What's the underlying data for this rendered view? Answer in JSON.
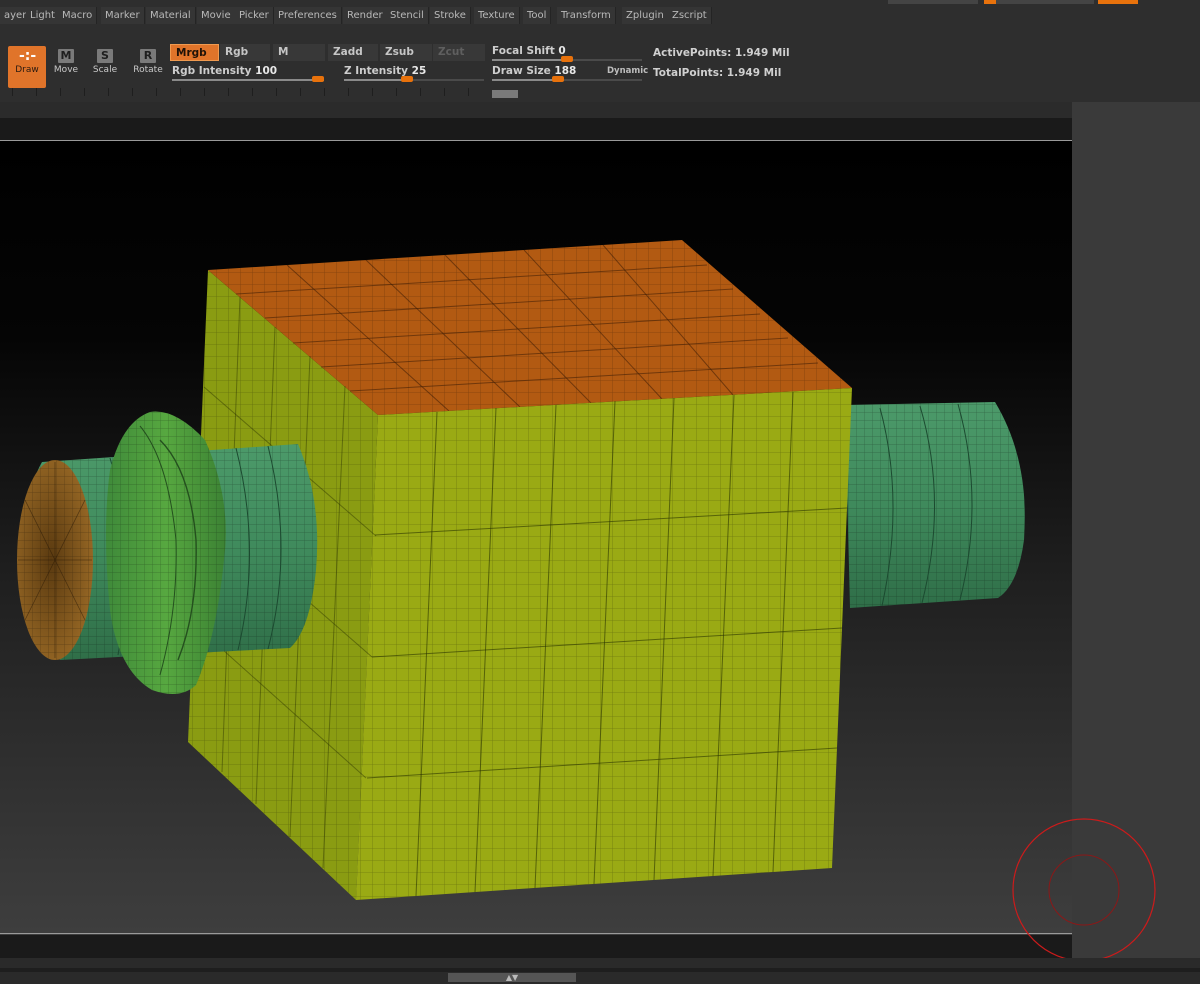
{
  "menu": [
    "ayer",
    "Light",
    "Macro",
    "Marker",
    "Material",
    "Movie",
    "Picker",
    "Preferences",
    "Render",
    "Stencil",
    "Stroke",
    "Texture",
    "Tool",
    "Transform",
    "Zplugin",
    "Zscript"
  ],
  "tools": {
    "draw": {
      "label": "Draw",
      "icon": "draw-crosshair-icon",
      "glyph": "-:-"
    },
    "move": {
      "label": "Move",
      "icon": "move-icon",
      "glyph": "M"
    },
    "scale": {
      "label": "Scale",
      "icon": "scale-icon",
      "glyph": "S"
    },
    "rotate": {
      "label": "Rotate",
      "icon": "rotate-icon",
      "glyph": "R"
    }
  },
  "modes": {
    "mrgb": "Mrgb",
    "rgb": "Rgb",
    "m": "M",
    "zadd": "Zadd",
    "zsub": "Zsub",
    "zcut": "Zcut"
  },
  "sliders": {
    "rgb_intensity": {
      "label": "Rgb Intensity",
      "value": "100"
    },
    "z_intensity": {
      "label": "Z Intensity",
      "value": "25"
    },
    "focal_shift": {
      "label": "Focal Shift",
      "value": "0"
    },
    "draw_size": {
      "label": "Draw Size",
      "value": "188"
    },
    "dynamic_label": "Dynamic"
  },
  "stats": {
    "active_points": "ActivePoints: 1.949 Mil",
    "total_points": "TotalPoints: 1.949 Mil"
  },
  "colors": {
    "accent": "#e0742a",
    "cube_front": "#9aaa14",
    "cube_top": "#b25a12",
    "cylinder": "#3f8a5c",
    "ring": "#4a9a35",
    "cap": "#8a5a1c",
    "brush_cursor": "#cc1b1b"
  }
}
